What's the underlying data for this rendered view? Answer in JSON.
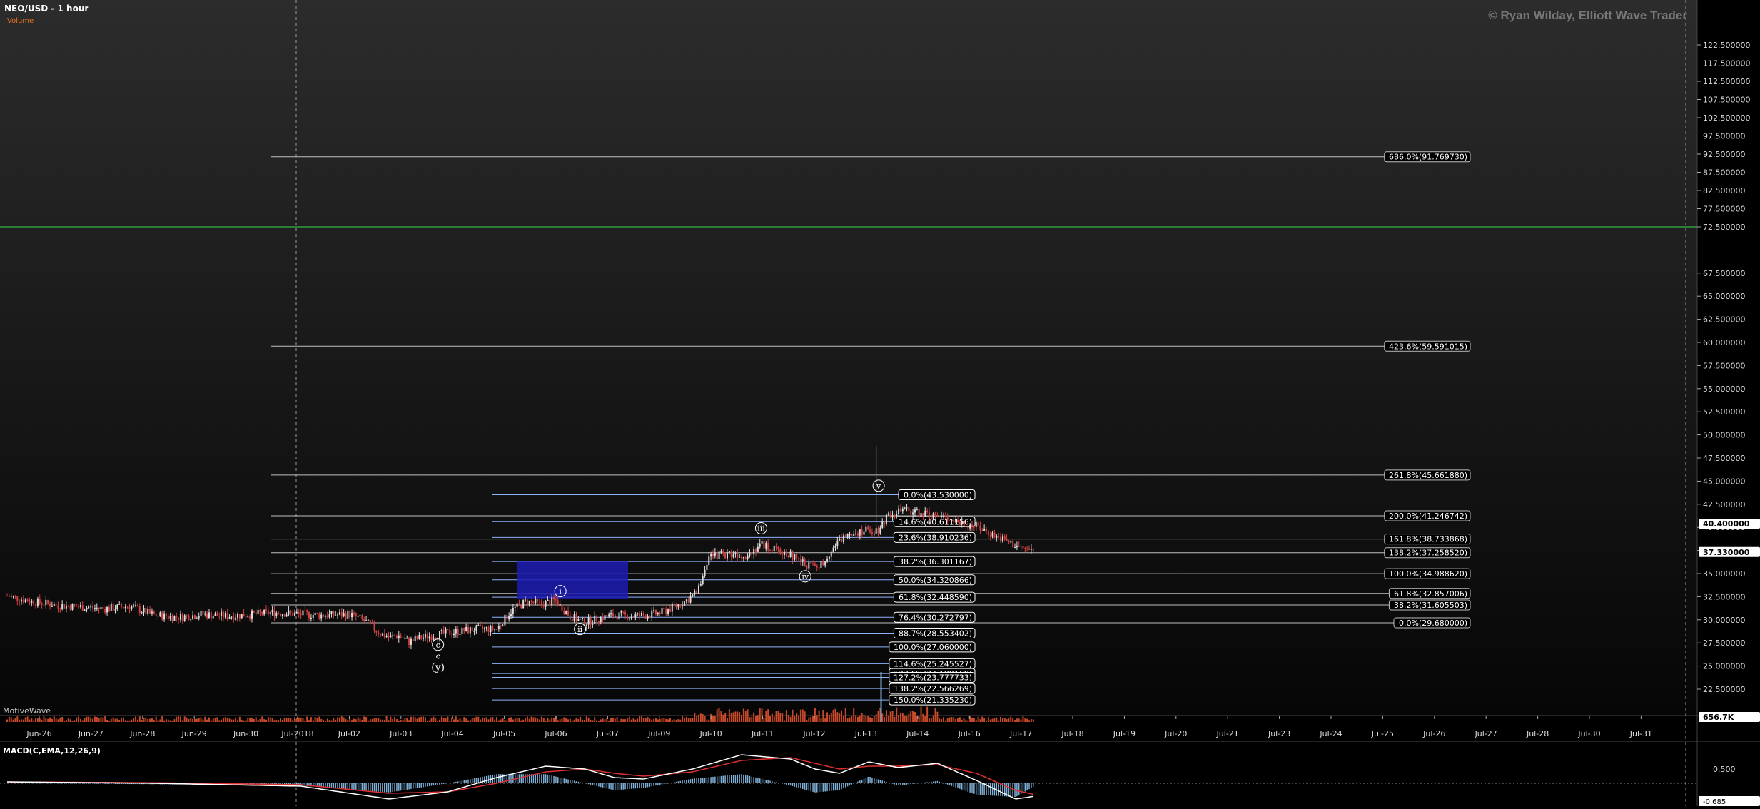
{
  "header": {
    "title": "NEO/USD - 1 hour",
    "volume_label": "Volume",
    "watermark": "© Ryan Wilday, Elliott Wave Trader",
    "motivewave_label": "MotiveWave"
  },
  "colors": {
    "background_top": "#2a2a2a",
    "background_bottom": "#050505",
    "grid_dashed": "#9a9a9a",
    "fib_white": "#bfbfbf",
    "fib_blue": "#8fb4ff",
    "green_line": "#2e9e3e",
    "target_box": "#1c1cb4",
    "candle_up": "#dddddd",
    "candle_down": "#d04040",
    "volume": "#c84a2a",
    "macd_line": "#ffffff",
    "signal_line": "#e03030",
    "histogram": "#7fb0d8"
  },
  "price_axis": {
    "ticks": [
      "122.500000",
      "117.500000",
      "112.500000",
      "107.500000",
      "102.500000",
      "97.500000",
      "92.500000",
      "87.500000",
      "82.500000",
      "77.500000",
      "72.500000",
      "67.500000",
      "65.000000",
      "62.500000",
      "60.000000",
      "57.500000",
      "55.000000",
      "52.500000",
      "50.000000",
      "47.500000",
      "45.000000",
      "42.500000",
      "40.000000",
      "37.500000",
      "35.000000",
      "32.500000",
      "30.000000",
      "27.500000",
      "25.000000",
      "22.500000"
    ],
    "current_high_label": "40.400000",
    "current_price_label": "37.330000",
    "volume_label": "656.7K"
  },
  "time_axis": {
    "labels": [
      "Jun-26",
      "Jun-27",
      "Jun-28",
      "Jun-29",
      "Jun-30",
      "Jul-2018",
      "Jul-02",
      "Jul-03",
      "Jul-04",
      "Jul-05",
      "Jul-06",
      "Jul-07",
      "Jul-09",
      "Jul-10",
      "Jul-11",
      "Jul-12",
      "Jul-13",
      "Jul-14",
      "Jul-16",
      "Jul-17",
      "Jul-18",
      "Jul-19",
      "Jul-20",
      "Jul-21",
      "Jul-23",
      "Jul-24",
      "Jul-25",
      "Jul-26",
      "Jul-27",
      "Jul-28",
      "Jul-30",
      "Jul-31"
    ]
  },
  "macd": {
    "label": "MACD(C,EMA,12,26,9)",
    "tick_label": "0.500",
    "bottom_label": "-0.685"
  },
  "chart_data": {
    "type": "candlestick",
    "title": "NEO/USD - 1 hour",
    "y_scale": "mixed (compressed above 72.5)",
    "green_line_level": 72.5,
    "target_box": {
      "from": 32.3,
      "to": 36.3
    },
    "right_fib_levels": [
      {
        "label": "686.0%(91.769730)",
        "value": 91.76973
      },
      {
        "label": "423.6%(59.591015)",
        "value": 59.591015
      },
      {
        "label": "261.8%(45.661880)",
        "value": 45.66188
      },
      {
        "label": "200.0%(41.246742)",
        "value": 41.246742
      },
      {
        "label": "161.8%(38.733868)",
        "value": 38.733868
      },
      {
        "label": "138.2%(37.258520)",
        "value": 37.25852
      },
      {
        "label": "100.0%(34.988620)",
        "value": 34.98862
      },
      {
        "label": "61.8%(32.857006)",
        "value": 32.857006
      },
      {
        "label": "38.2%(31.605503)",
        "value": 31.605503
      },
      {
        "label": "0.0%(29.680000)",
        "value": 29.68
      }
    ],
    "retracement_levels": [
      {
        "label": "0.0%(43.530000)",
        "value": 43.53
      },
      {
        "label": "14.6%(40.611156)",
        "value": 40.611156
      },
      {
        "label": "23.6%(38.910236)",
        "value": 38.910236
      },
      {
        "label": "38.2%(36.301167)",
        "value": 36.301167
      },
      {
        "label": "50.0%(34.320866)",
        "value": 34.320866
      },
      {
        "label": "61.8%(32.448590)",
        "value": 32.44859
      },
      {
        "label": "76.4%(30.272797)",
        "value": 30.272797
      },
      {
        "label": "88.7%(28.553402)",
        "value": 28.553402
      },
      {
        "label": "100.0%(27.060000)",
        "value": 27.06
      },
      {
        "label": "114.6%(25.245527)",
        "value": 25.245527
      },
      {
        "label": "123.6%(24.188168)",
        "value": 24.188168
      },
      {
        "label": "127.2%(23.777733)",
        "value": 23.777733
      },
      {
        "label": "138.2%(22.566269)",
        "value": 22.566269
      },
      {
        "label": "150.0%(21.335230)",
        "value": 21.33523
      }
    ],
    "wave_labels": [
      {
        "text": "i",
        "x": 11.3,
        "y": 33.1
      },
      {
        "text": "ii",
        "x": 11.7,
        "y": 29.0
      },
      {
        "text": "iii",
        "x": 15.4,
        "y": 39.9
      },
      {
        "text": "iv",
        "x": 16.3,
        "y": 34.7
      },
      {
        "text": "v",
        "x": 17.8,
        "y": 44.5
      },
      {
        "text": "c",
        "x": 8.8,
        "y": 27.3
      },
      {
        "text": "c",
        "x": 8.8,
        "y": 26.1
      },
      {
        "text": "(y)",
        "x": 8.8,
        "y": 24.8
      }
    ],
    "price_path": [
      [
        0,
        32.6
      ],
      [
        0.5,
        32.0
      ],
      [
        1,
        31.6
      ],
      [
        1.5,
        31.4
      ],
      [
        2,
        31.2
      ],
      [
        2.5,
        31.5
      ],
      [
        3,
        30.5
      ],
      [
        3.5,
        30.3
      ],
      [
        4,
        30.6
      ],
      [
        4.5,
        30.4
      ],
      [
        5,
        30.6
      ],
      [
        5.5,
        30.8
      ],
      [
        6,
        30.6
      ],
      [
        6.5,
        30.5
      ],
      [
        7,
        30.6
      ],
      [
        7.3,
        29.9
      ],
      [
        7.6,
        28.6
      ],
      [
        7.8,
        28.1
      ],
      [
        8.0,
        28.3
      ],
      [
        8.2,
        27.6
      ],
      [
        8.4,
        28.0
      ],
      [
        8.7,
        28.3
      ],
      [
        9.0,
        28.6
      ],
      [
        9.3,
        28.8
      ],
      [
        9.6,
        29.0
      ],
      [
        10.0,
        29.0
      ],
      [
        10.3,
        31.0
      ],
      [
        10.6,
        32.0
      ],
      [
        10.9,
        31.7
      ],
      [
        11.2,
        32.1
      ],
      [
        11.5,
        30.4
      ],
      [
        11.8,
        29.7
      ],
      [
        12.1,
        30.2
      ],
      [
        12.4,
        30.5
      ],
      [
        12.7,
        30.4
      ],
      [
        13.0,
        30.5
      ],
      [
        13.3,
        30.7
      ],
      [
        13.6,
        31.3
      ],
      [
        13.9,
        32.2
      ],
      [
        14.1,
        33.0
      ],
      [
        14.3,
        36.5
      ],
      [
        14.5,
        37.0
      ],
      [
        14.8,
        37.2
      ],
      [
        15.1,
        37.0
      ],
      [
        15.4,
        38.2
      ],
      [
        15.7,
        37.5
      ],
      [
        16.0,
        37.0
      ],
      [
        16.3,
        36.0
      ],
      [
        16.6,
        35.8
      ],
      [
        16.9,
        38.0
      ],
      [
        17.2,
        39.5
      ],
      [
        17.5,
        39.6
      ],
      [
        17.8,
        39.8
      ],
      [
        18.0,
        41.5
      ],
      [
        18.3,
        41.8
      ],
      [
        18.6,
        41.6
      ],
      [
        18.9,
        41.3
      ],
      [
        19.2,
        41.0
      ],
      [
        19.5,
        40.5
      ],
      [
        19.8,
        40.1
      ],
      [
        20.1,
        39.3
      ],
      [
        20.4,
        38.5
      ],
      [
        20.7,
        37.8
      ],
      [
        21.0,
        37.4
      ]
    ],
    "spike_high": 48.8,
    "macd_series": {
      "x_range": [
        0,
        21.5
      ],
      "macd": [
        [
          0,
          0.05
        ],
        [
          3,
          0.0
        ],
        [
          6,
          -0.1
        ],
        [
          7.8,
          -0.55
        ],
        [
          9,
          -0.3
        ],
        [
          10,
          0.2
        ],
        [
          11,
          0.6
        ],
        [
          11.8,
          0.5
        ],
        [
          12.4,
          0.2
        ],
        [
          13,
          0.15
        ],
        [
          14,
          0.5
        ],
        [
          15,
          1.0
        ],
        [
          16,
          0.85
        ],
        [
          16.5,
          0.5
        ],
        [
          17,
          0.35
        ],
        [
          17.6,
          0.75
        ],
        [
          18.2,
          0.55
        ],
        [
          19,
          0.7
        ],
        [
          19.8,
          0.1
        ],
        [
          20.6,
          -0.55
        ],
        [
          21.0,
          -0.45
        ]
      ],
      "signal": [
        [
          0,
          0.05
        ],
        [
          3,
          0.02
        ],
        [
          6,
          -0.05
        ],
        [
          7.8,
          -0.35
        ],
        [
          9,
          -0.3
        ],
        [
          10,
          0.0
        ],
        [
          11,
          0.4
        ],
        [
          11.8,
          0.5
        ],
        [
          12.4,
          0.35
        ],
        [
          13,
          0.25
        ],
        [
          14,
          0.4
        ],
        [
          15,
          0.8
        ],
        [
          16,
          0.9
        ],
        [
          16.5,
          0.7
        ],
        [
          17,
          0.5
        ],
        [
          17.6,
          0.6
        ],
        [
          18.2,
          0.6
        ],
        [
          19,
          0.65
        ],
        [
          19.8,
          0.35
        ],
        [
          20.6,
          -0.25
        ],
        [
          21.0,
          -0.4
        ]
      ]
    }
  }
}
